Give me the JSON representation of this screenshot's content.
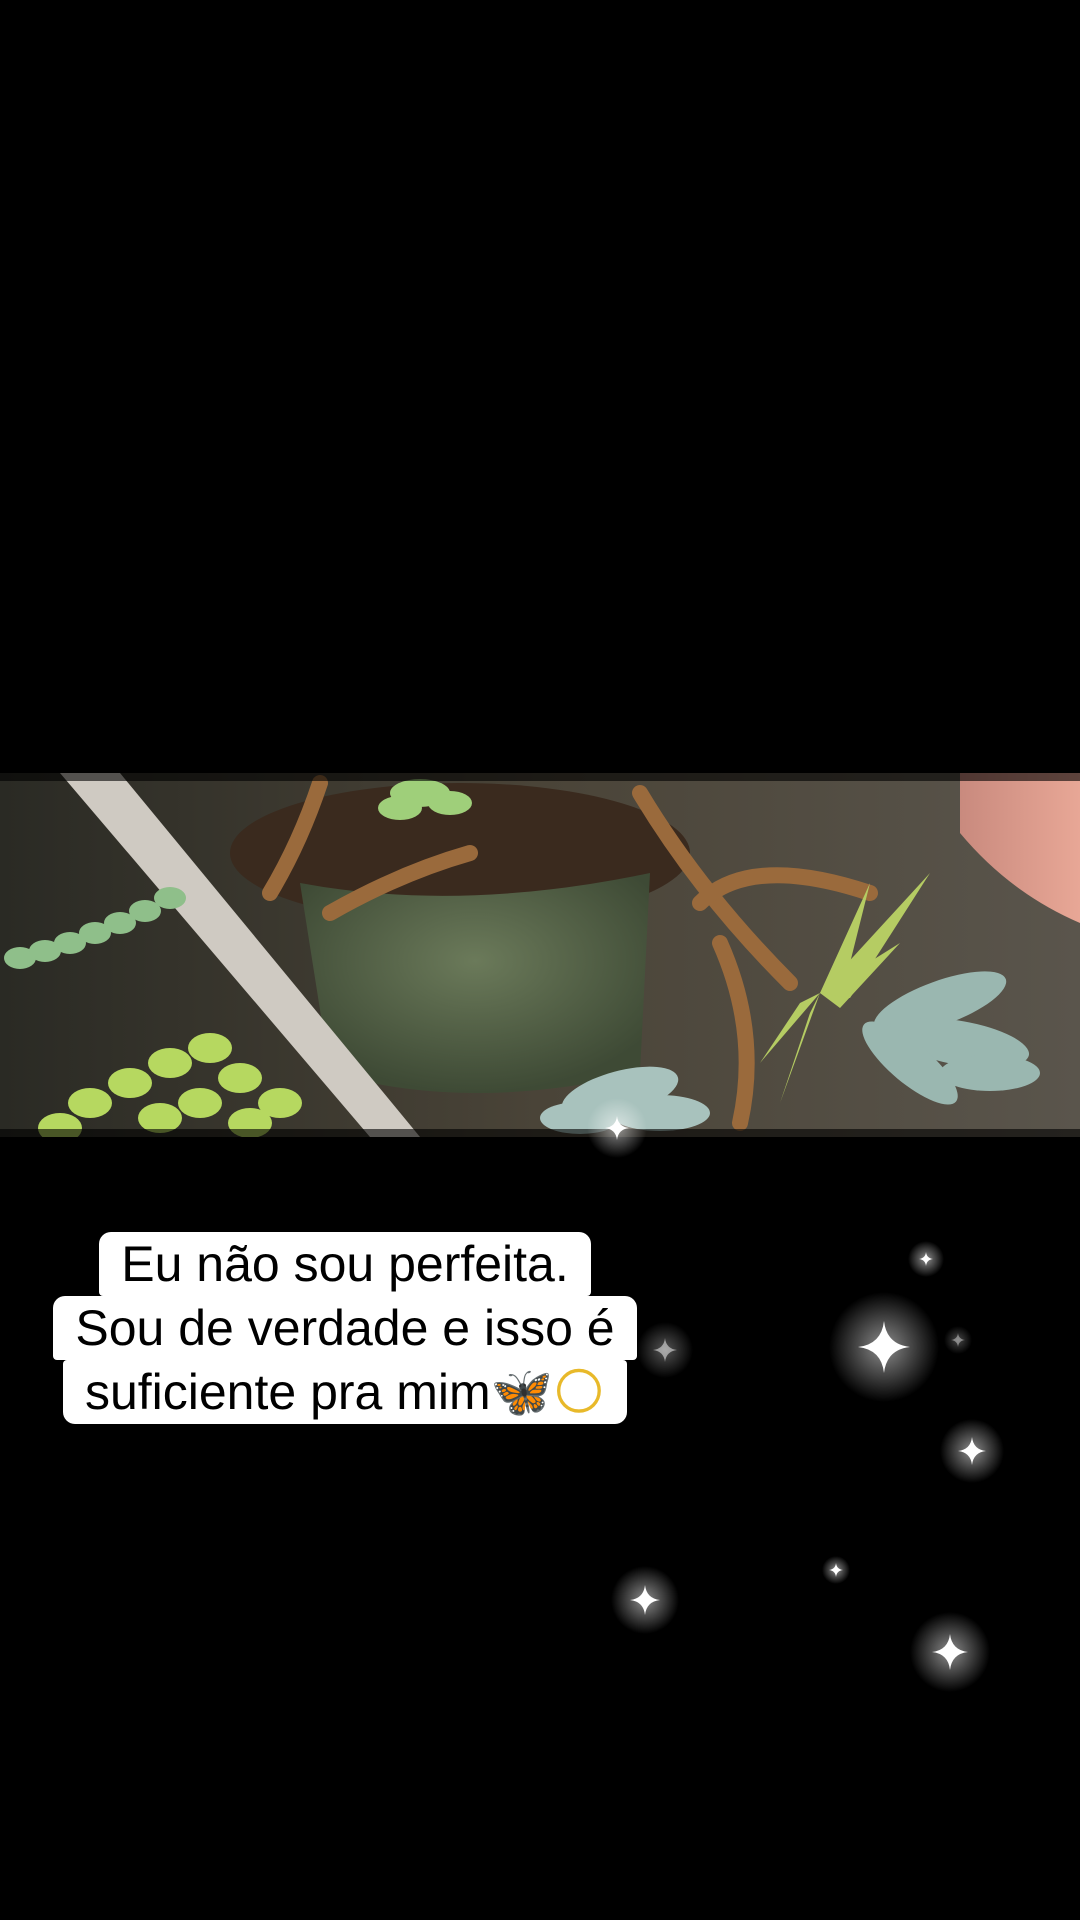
{
  "caption": {
    "line1": "Eu não sou perfeita.",
    "line2": "Sou de verdade e isso é",
    "line3_text": "suficiente pra mim",
    "line3_emoji_1": "🦋",
    "line3_emoji_2": "🌕"
  },
  "video": {
    "scene_icon": "succulent-plants-photo"
  },
  "colors": {
    "background": "#000000",
    "caption_bg": "#ffffff",
    "caption_text": "#000000"
  }
}
